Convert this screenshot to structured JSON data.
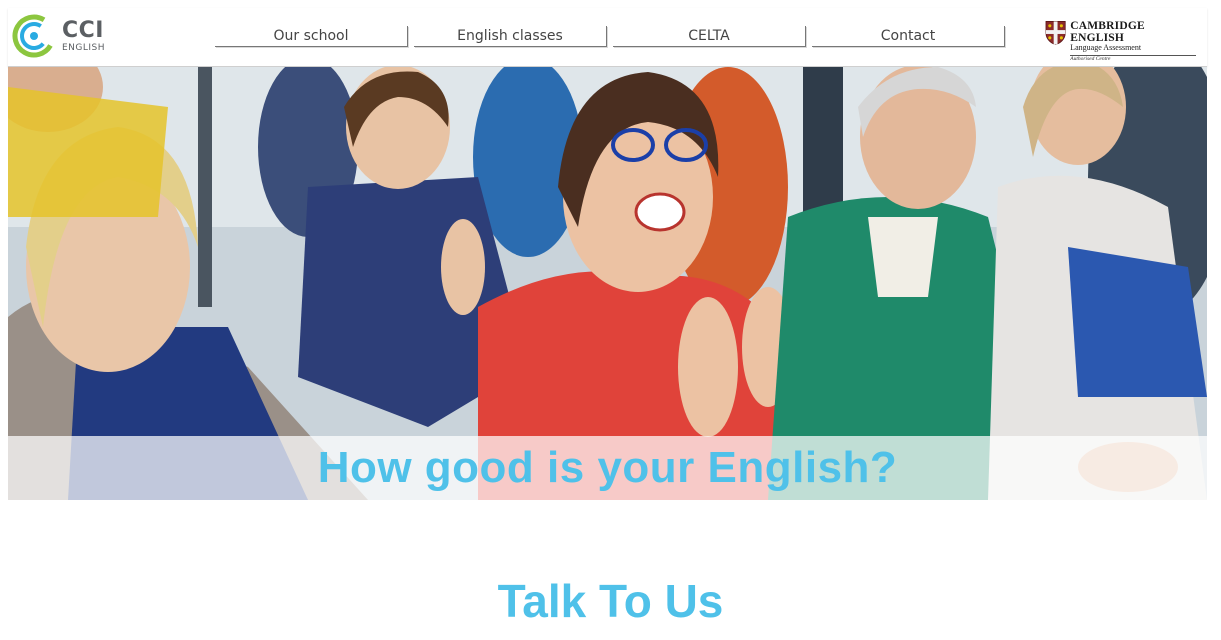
{
  "brand": {
    "logo_main": "CCI",
    "logo_sub": "ENGLISH",
    "logo_colors": {
      "ring_green": "#8cc63f",
      "ring_blue": "#29abe2",
      "text": "#5b5f63"
    }
  },
  "nav": {
    "items": [
      {
        "label": "Our school"
      },
      {
        "label": "English classes"
      },
      {
        "label": "CELTA"
      },
      {
        "label": "Contact"
      }
    ]
  },
  "partner": {
    "title": "CAMBRIDGE ENGLISH",
    "subtitle": "Language Assessment",
    "center": "Authorised Centre",
    "shield_color": "#8b2a2a"
  },
  "hero": {
    "caption": "How good is your English?",
    "caption_color": "#4fc1e9"
  },
  "sections": {
    "talk_heading": "Talk To Us"
  }
}
